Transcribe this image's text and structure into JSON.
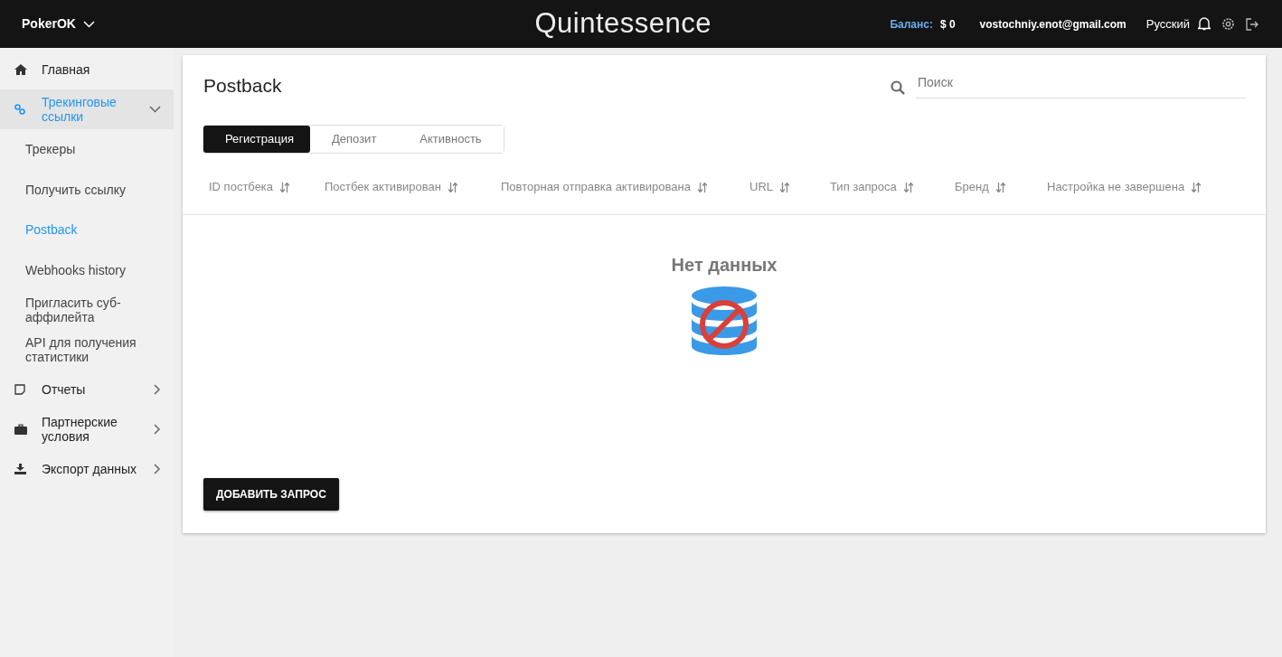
{
  "header": {
    "brand": "PokerOK",
    "title": "Quintessence",
    "balance_label": "Баланс:",
    "balance": "$ 0",
    "email": "vostochniy.enot@gmail.com",
    "language": "Русский"
  },
  "sidebar": {
    "items": [
      {
        "kind": "link",
        "label": "Главная",
        "expanded": false
      },
      {
        "kind": "group",
        "label": "Трекинговые ссылки",
        "expanded": true,
        "children": [
          {
            "label": "Трекеры",
            "selected": false
          },
          {
            "label": "Получить ссылку",
            "selected": false
          },
          {
            "label": "Postback",
            "selected": true
          },
          {
            "label": "Webhooks history",
            "selected": false
          },
          {
            "label": "Пригласить суб-аффилейта",
            "selected": false
          },
          {
            "label": "API для получения статистики",
            "selected": false
          }
        ]
      },
      {
        "kind": "group",
        "label": "Отчеты",
        "expanded": false
      },
      {
        "kind": "group",
        "label": "Партнерские условия",
        "expanded": false
      },
      {
        "kind": "group",
        "label": "Экспорт данных",
        "expanded": false
      }
    ]
  },
  "page": {
    "title": "Postback",
    "search": {
      "placeholder": "Поиск"
    },
    "tabs": [
      {
        "label": "Регистрация",
        "selected": true
      },
      {
        "label": "Депозит",
        "selected": false
      },
      {
        "label": "Активность",
        "selected": false
      }
    ],
    "table": {
      "columns": [
        "ID постбека",
        "Постбек активирован",
        "Повторная отправка активирована",
        "URL",
        "Тип запроса",
        "Бренд",
        "Настройка не завершена"
      ],
      "empty_text": "Нет данных"
    },
    "add_button": "ДОБАВИТЬ ЗАПРОС"
  }
}
